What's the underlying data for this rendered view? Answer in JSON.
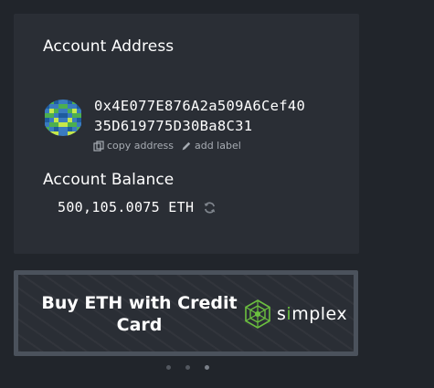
{
  "account": {
    "address_title": "Account Address",
    "address_line1": "0x4E077E876A2a509A6Cef40",
    "address_line2": "35D619775D30Ba8C31",
    "copy_label": "copy address",
    "add_label": "add label",
    "balance_title": "Account Balance",
    "balance_value": "500,105.0075 ETH"
  },
  "buy": {
    "text": "Buy ETH with Credit Card",
    "provider_prefix": "s",
    "provider_i": "i",
    "provider_suffix": "mplex"
  },
  "pager": {
    "count": 3,
    "active_index": 2
  },
  "colors": {
    "background": "#21252b",
    "card": "#2a2e35",
    "buy_border": "#4b525c",
    "simplex_green": "#6bbf3f",
    "muted_text": "#a7acb3"
  }
}
